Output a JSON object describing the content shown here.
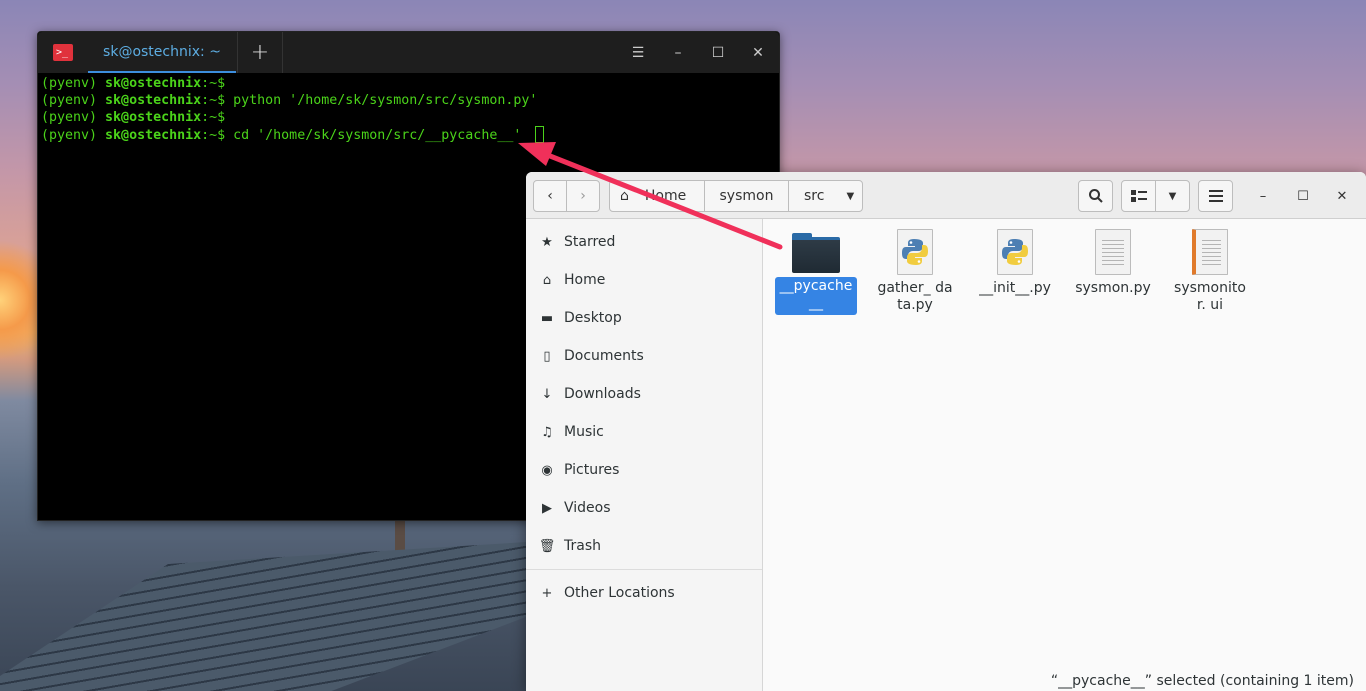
{
  "terminal": {
    "tab_title": "sk@ostechnix: ~",
    "new_tab": "+",
    "icon_glyph": ">_",
    "menu_glyph": "☰",
    "min_glyph": "–",
    "max_glyph": "☐",
    "close_glyph": "✕",
    "lines": [
      {
        "env": "(pyenv) ",
        "prompt": "sk@ostechnix",
        "rest": ":~$"
      },
      {
        "env": "(pyenv) ",
        "prompt": "sk@ostechnix",
        "rest": ":~$ python '/home/sk/sysmon/src/sysmon.py'"
      },
      {
        "env": "(pyenv) ",
        "prompt": "sk@ostechnix",
        "rest": ":~$"
      },
      {
        "env": "(pyenv) ",
        "prompt": "sk@ostechnix",
        "rest": ":~$ cd '/home/sk/sysmon/src/__pycache__' "
      }
    ]
  },
  "files": {
    "breadcrumbs": {
      "home": "Home",
      "sysmon": "sysmon",
      "src": "src"
    },
    "sidebar": {
      "items": [
        {
          "label": "Starred",
          "icon": "★"
        },
        {
          "label": "Home",
          "icon": "⌂"
        },
        {
          "label": "Desktop",
          "icon": "▬"
        },
        {
          "label": "Documents",
          "icon": "▯"
        },
        {
          "label": "Downloads",
          "icon": "↓"
        },
        {
          "label": "Music",
          "icon": "♫"
        },
        {
          "label": "Pictures",
          "icon": "◉"
        },
        {
          "label": "Videos",
          "icon": "▶"
        },
        {
          "label": "Trash",
          "icon": "🗑"
        }
      ],
      "other": {
        "label": "Other Locations",
        "icon": "+"
      }
    },
    "items": [
      {
        "name": "__pycache__",
        "type": "folder",
        "selected": true
      },
      {
        "name": "gather_ data.py",
        "type": "python"
      },
      {
        "name": "__init__.py",
        "type": "python"
      },
      {
        "name": "sysmon.py",
        "type": "text"
      },
      {
        "name": "sysmonitor. ui",
        "type": "ui"
      }
    ],
    "status": "“__pycache__” selected  (containing 1 item)"
  },
  "colors": {
    "accent": "#3584e4",
    "terminal_green": "#4bd31a",
    "arrow": "#f0305a"
  }
}
